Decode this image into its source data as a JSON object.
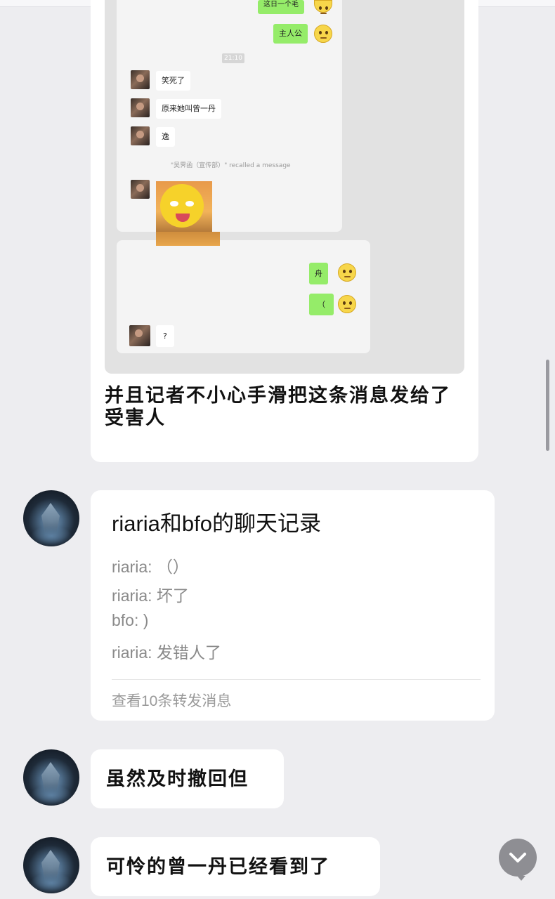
{
  "screenshot": {
    "top_bubble_label": "这日一个毛",
    "owner_label": "主人公",
    "time": "21:10",
    "messages_left": [
      "笑死了",
      "原来她叫曾一丹",
      "逸"
    ],
    "recalled_notice": "\"吴霁函（宣传部）\" recalled a message",
    "messages_right": [
      "舟",
      "（"
    ],
    "last_left": "?"
  },
  "message1_text": "并且记者不小心手滑把这条消息发给了受害人",
  "chat_record": {
    "title": "riaria和bfo的聊天记录",
    "lines": [
      "riaria: （）",
      "riaria: 坏了",
      "bfo: )",
      "riaria: 发错人了"
    ],
    "footer": "查看10条转发消息"
  },
  "message2_text": "虽然及时撤回但",
  "message3_text": "可怜的曾一丹已经看到了",
  "icons": {
    "scroll_down": "chevron-down-icon",
    "avatar": "avatar-image",
    "emoji": "smiley-emoji"
  },
  "colors": {
    "background": "#ededf0",
    "bubble": "#ffffff",
    "wechat_green": "#95ec69"
  }
}
